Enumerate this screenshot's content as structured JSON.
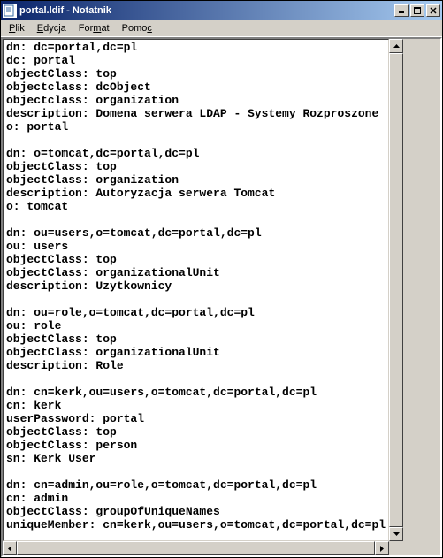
{
  "window": {
    "title": "portal.ldif - Notatnik"
  },
  "menu": {
    "file": "Plik",
    "edit": "Edycja",
    "format": "Format",
    "help": "Pomoc"
  },
  "content": "dn: dc=portal,dc=pl\ndc: portal\nobjectClass: top\nobjectclass: dcObject\nobjectclass: organization\ndescription: Domena serwera LDAP - Systemy Rozproszone\no: portal\n\ndn: o=tomcat,dc=portal,dc=pl\nobjectClass: top\nobjectClass: organization\ndescription: Autoryzacja serwera Tomcat\no: tomcat\n\ndn: ou=users,o=tomcat,dc=portal,dc=pl\nou: users\nobjectClass: top\nobjectClass: organizationalUnit\ndescription: Uzytkownicy\n\ndn: ou=role,o=tomcat,dc=portal,dc=pl\nou: role\nobjectClass: top\nobjectClass: organizationalUnit\ndescription: Role\n\ndn: cn=kerk,ou=users,o=tomcat,dc=portal,dc=pl\ncn: kerk\nuserPassword: portal\nobjectClass: top\nobjectClass: person\nsn: Kerk User\n\ndn: cn=admin,ou=role,o=tomcat,dc=portal,dc=pl\ncn: admin\nobjectClass: groupOfUniqueNames\nuniqueMember: cn=kerk,ou=users,o=tomcat,dc=portal,dc=pl"
}
